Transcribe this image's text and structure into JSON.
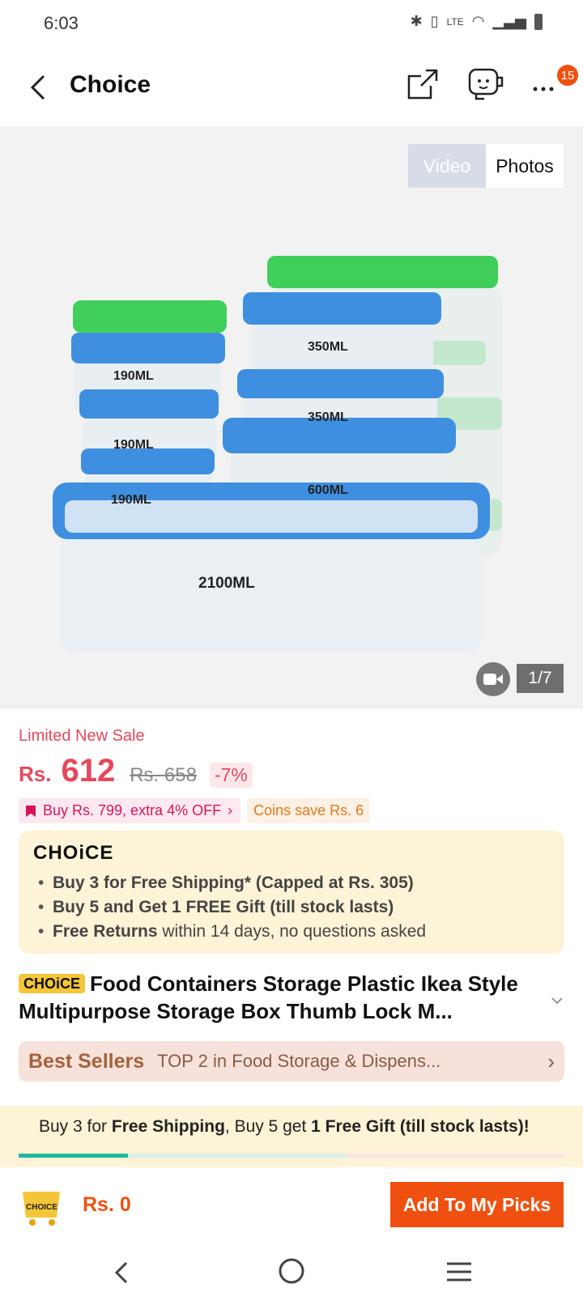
{
  "status": {
    "time": "6:03"
  },
  "header": {
    "title": "Choice",
    "badge_count": "15"
  },
  "gallery": {
    "tab_video": "Video",
    "tab_photos": "Photos",
    "counter": "1/7",
    "container_labels": [
      "190ML",
      "190ML",
      "190ML",
      "350ML",
      "350ML",
      "600ML",
      "2100ML"
    ]
  },
  "pricing": {
    "sale_label": "Limited New Sale",
    "currency": "Rs.",
    "price": "612",
    "original": "Rs. 658",
    "discount": "-7%"
  },
  "promos": {
    "coupon": "Buy Rs. 799, extra 4% OFF",
    "coins": "Coins save Rs. 6"
  },
  "choice_box": {
    "logo": "CHOiCE",
    "item1": "Buy 3 for  Free Shipping* (Capped at Rs. 305)",
    "item2": "Buy 5 and Get 1 FREE Gift (till stock lasts)",
    "item3_bold": "Free Returns",
    "item3_rest": " within 14 days, no questions asked"
  },
  "product": {
    "badge": "CHOiCE",
    "title": "Food Containers Storage Plastic Ikea Style Multipurpose Storage Box Thumb Lock M..."
  },
  "best_sellers": {
    "label": "Best Sellers",
    "text": "TOP 2 in Food Storage & Dispens..."
  },
  "ship_bar": {
    "p1": "Buy 3 for ",
    "p2": "Free Shipping",
    "p3": ", Buy 5 get ",
    "p4": "1 Free Gift (till stock lasts)!",
    "progress": 0.2
  },
  "bottom": {
    "cart_label": "CHOICE",
    "price": "Rs. 0",
    "add_button": "Add To My Picks"
  },
  "colors": {
    "accent": "#f0500f",
    "sale": "#e5485c"
  }
}
